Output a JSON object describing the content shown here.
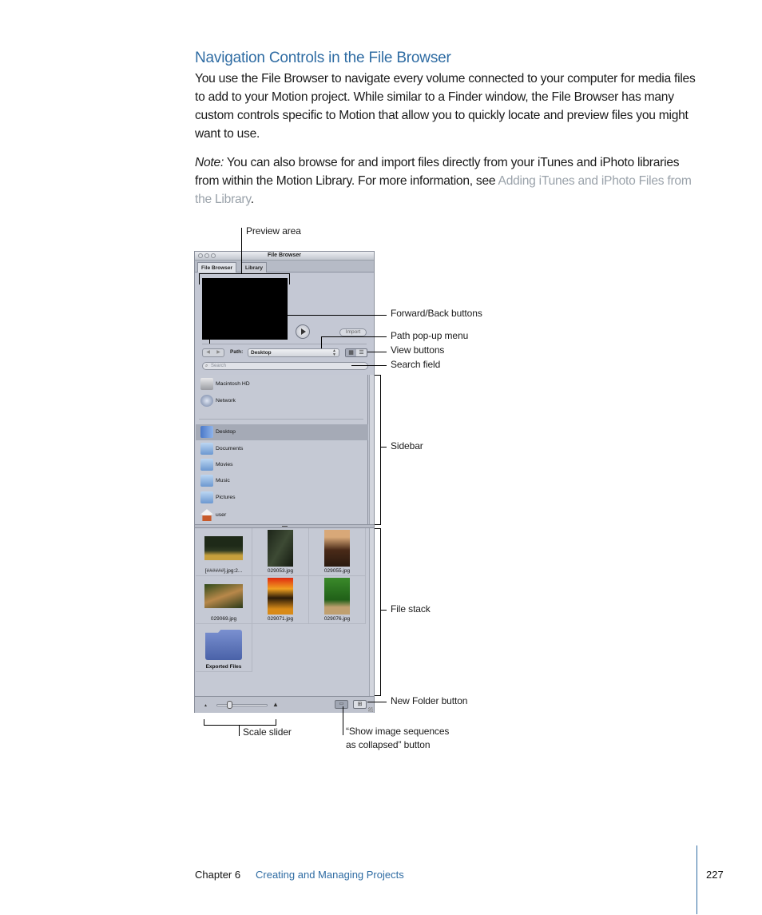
{
  "heading": "Navigation Controls in the File Browser",
  "intro_paragraph": "You use the File Browser to navigate every volume connected to your computer for media files to add to your Motion project. While similar to a Finder window, the File Browser has many custom controls specific to Motion that allow you to quickly locate and preview files you might want to use.",
  "note": {
    "label": "Note:",
    "text": "  You can also browse for and import files directly from your iTunes and iPhoto libraries from within the Motion Library. For more information, see ",
    "link_text": "Adding iTunes and iPhoto Files from the Library",
    "end": "."
  },
  "window": {
    "title": "File Browser",
    "tabs": [
      {
        "label": "File Browser",
        "active": true
      },
      {
        "label": "Library",
        "active": false
      }
    ],
    "import_label": "Import",
    "path_label": "Path:",
    "path_value": "Desktop",
    "search_placeholder": "Search",
    "back_glyph": "◀",
    "forward_glyph": "▶",
    "icon_view_glyph": "▦",
    "list_view_glyph": "☰",
    "sidebar": [
      {
        "label": "Macintosh HD",
        "icon": "hard-drive-icon",
        "selected": false
      },
      {
        "label": "Network",
        "icon": "network-icon",
        "selected": false
      },
      {
        "label": "Desktop",
        "icon": "desktop-folder-icon",
        "selected": true
      },
      {
        "label": "Documents",
        "icon": "documents-folder-icon",
        "selected": false
      },
      {
        "label": "Movies",
        "icon": "movies-folder-icon",
        "selected": false
      },
      {
        "label": "Music",
        "icon": "music-folder-icon",
        "selected": false
      },
      {
        "label": "Pictures",
        "icon": "pictures-folder-icon",
        "selected": false
      },
      {
        "label": "user",
        "icon": "home-icon",
        "selected": false
      }
    ],
    "files": [
      {
        "label": "[######].jpg:2...",
        "kind": "image-sequence"
      },
      {
        "label": "029053.jpg",
        "kind": "image"
      },
      {
        "label": "029055.jpg",
        "kind": "image"
      },
      {
        "label": "029069.jpg",
        "kind": "image"
      },
      {
        "label": "029071.jpg",
        "kind": "image"
      },
      {
        "label": "029076.jpg",
        "kind": "image"
      },
      {
        "label": "Exported Files",
        "kind": "folder"
      }
    ],
    "scale_slider_value": 0.25
  },
  "callouts": {
    "preview_area": "Preview area",
    "forward_back": "Forward/Back buttons",
    "path_popup": "Path pop-up menu",
    "view_buttons": "View buttons",
    "search_field": "Search field",
    "sidebar": "Sidebar",
    "file_stack": "File stack",
    "new_folder": "New Folder button",
    "scale_slider": "Scale slider",
    "show_sequences_line1": "“Show image sequences",
    "show_sequences_line2": "as collapsed” button"
  },
  "footer": {
    "chapter": "Chapter 6",
    "title": "Creating and Managing Projects",
    "page": "227"
  },
  "colors": {
    "accent_blue": "#2f6ca3",
    "link_gray": "#9aa2aa",
    "window_bg": "#c4c8d4"
  }
}
